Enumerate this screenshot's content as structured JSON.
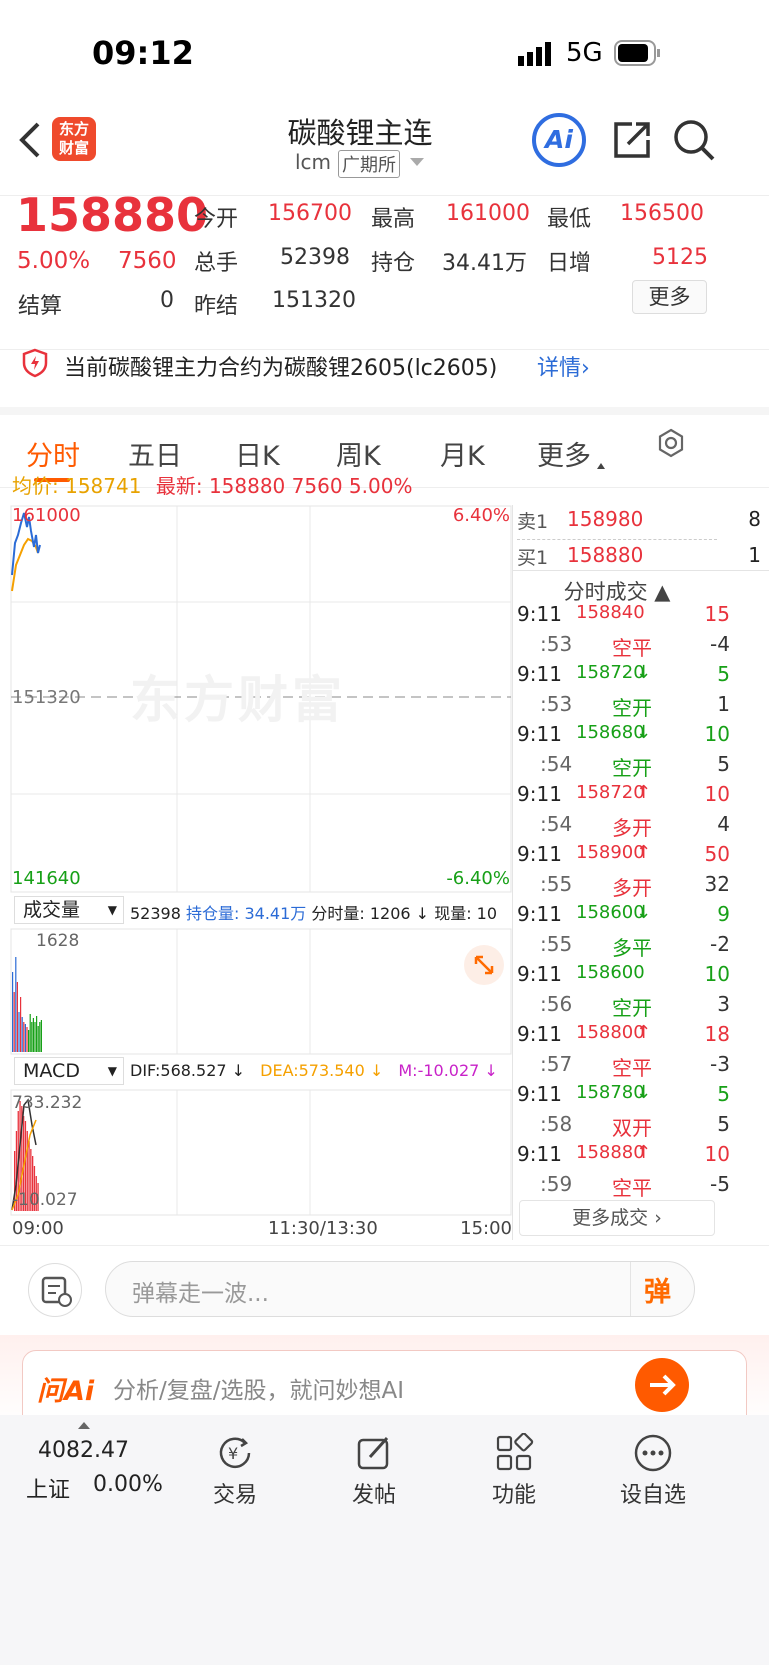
{
  "status": {
    "time": "09:12",
    "network": "5G"
  },
  "header": {
    "title": "碳酸锂主连",
    "code": "lcm",
    "exchange": "广期所",
    "logo_text": "东方财富"
  },
  "quote": {
    "price": "158880",
    "pct": "5.00%",
    "change": "7560",
    "open_label": "今开",
    "open": "156700",
    "high_label": "最高",
    "high": "161000",
    "low_label": "最低",
    "low": "156500",
    "vol_label": "总手",
    "vol": "52398",
    "oi_label": "持仓",
    "oi": "34.41万",
    "inc_label": "日增",
    "inc": "5125",
    "settle_label": "结算",
    "settle": "0",
    "prev_label": "昨结",
    "prev": "151320",
    "more": "更多"
  },
  "notice": {
    "text": "当前碳酸锂主力合约为碳酸锂2605(lc2605)",
    "link": "详情"
  },
  "tabs": [
    "分时",
    "五日",
    "日K",
    "周K",
    "月K",
    "更多"
  ],
  "info": {
    "avg_label": "均价:",
    "avg": "158741",
    "latest_label": "最新:",
    "latest": "158880",
    "chg": "7560",
    "pct": "5.00%"
  },
  "chart": {
    "ymax": "161000",
    "ymid": "151320",
    "ymin": "141640",
    "pmax": "6.40%",
    "pmin": "-6.40%",
    "vol_selector": "成交量",
    "vol_total": "52398",
    "oi_text": "持仓量: 34.41万",
    "fs_text": "分时量: 1206 ↓",
    "now_text": "现量: 10",
    "vol_max": "1628",
    "macd_selector": "MACD",
    "dif": "DIF:568.527 ↓",
    "dea": "DEA:573.540 ↓",
    "m": "M:-10.027 ↓",
    "macd_max": "733.232",
    "macd_min": "-10.027",
    "x_start": "09:00",
    "x_mid": "11:30/13:30",
    "x_end": "15:00",
    "watermark": "东方财富"
  },
  "book": {
    "sell_label": "卖1",
    "sell_price": "158980",
    "sell_qty": "8",
    "buy_label": "买1",
    "buy_price": "158880",
    "buy_qty": "1",
    "trades_title": "分时成交 ▲",
    "more_trades": "更多成交 ›"
  },
  "trades": [
    {
      "t": "9:11",
      "v": "158840",
      "a": "",
      "q": "15",
      "c": "red"
    },
    {
      "t": ":53",
      "v": "空平",
      "q": "-4",
      "c": "red",
      "k": 1
    },
    {
      "t": "9:11",
      "v": "158720",
      "a": "↓",
      "q": "5",
      "c": "green"
    },
    {
      "t": ":53",
      "v": "空开",
      "q": "1",
      "c": "green",
      "k": 1
    },
    {
      "t": "9:11",
      "v": "158680",
      "a": "↓",
      "q": "10",
      "c": "green"
    },
    {
      "t": ":54",
      "v": "空开",
      "q": "5",
      "c": "green",
      "k": 1
    },
    {
      "t": "9:11",
      "v": "158720",
      "a": "↑",
      "q": "10",
      "c": "red"
    },
    {
      "t": ":54",
      "v": "多开",
      "q": "4",
      "c": "red",
      "k": 1
    },
    {
      "t": "9:11",
      "v": "158900",
      "a": "↑",
      "q": "50",
      "c": "red"
    },
    {
      "t": ":55",
      "v": "多开",
      "q": "32",
      "c": "red",
      "k": 1
    },
    {
      "t": "9:11",
      "v": "158600",
      "a": "↓",
      "q": "9",
      "c": "green"
    },
    {
      "t": ":55",
      "v": "多平",
      "q": "-2",
      "c": "green",
      "k": 1
    },
    {
      "t": "9:11",
      "v": "158600",
      "a": "",
      "q": "10",
      "c": "green"
    },
    {
      "t": ":56",
      "v": "空开",
      "q": "3",
      "c": "green",
      "k": 1
    },
    {
      "t": "9:11",
      "v": "158800",
      "a": "↑",
      "q": "18",
      "c": "red"
    },
    {
      "t": ":57",
      "v": "空平",
      "q": "-3",
      "c": "red",
      "k": 1
    },
    {
      "t": "9:11",
      "v": "158780",
      "a": "↓",
      "q": "5",
      "c": "green"
    },
    {
      "t": ":58",
      "v": "双开",
      "q": "5",
      "c": "red",
      "k": 1
    },
    {
      "t": "9:11",
      "v": "158880",
      "a": "↑",
      "q": "10",
      "c": "red"
    },
    {
      "t": ":59",
      "v": "空平",
      "q": "-5",
      "c": "red",
      "k": 1
    }
  ],
  "danmu": {
    "placeholder": "弹幕走一波...",
    "btn": "弹"
  },
  "ai": {
    "label": "问Ai",
    "placeholder": "分析/复盘/选股，就问妙想AI"
  },
  "nav": {
    "index_value": "4082.47",
    "index_name": "上证",
    "index_pct": "0.00%",
    "trade": "交易",
    "post": "发帖",
    "func": "功能",
    "watch": "设自选"
  },
  "colors": {
    "up": "#e8323c",
    "down": "#17a017",
    "accent": "#ff6a00",
    "blue": "#2b6bd6"
  }
}
